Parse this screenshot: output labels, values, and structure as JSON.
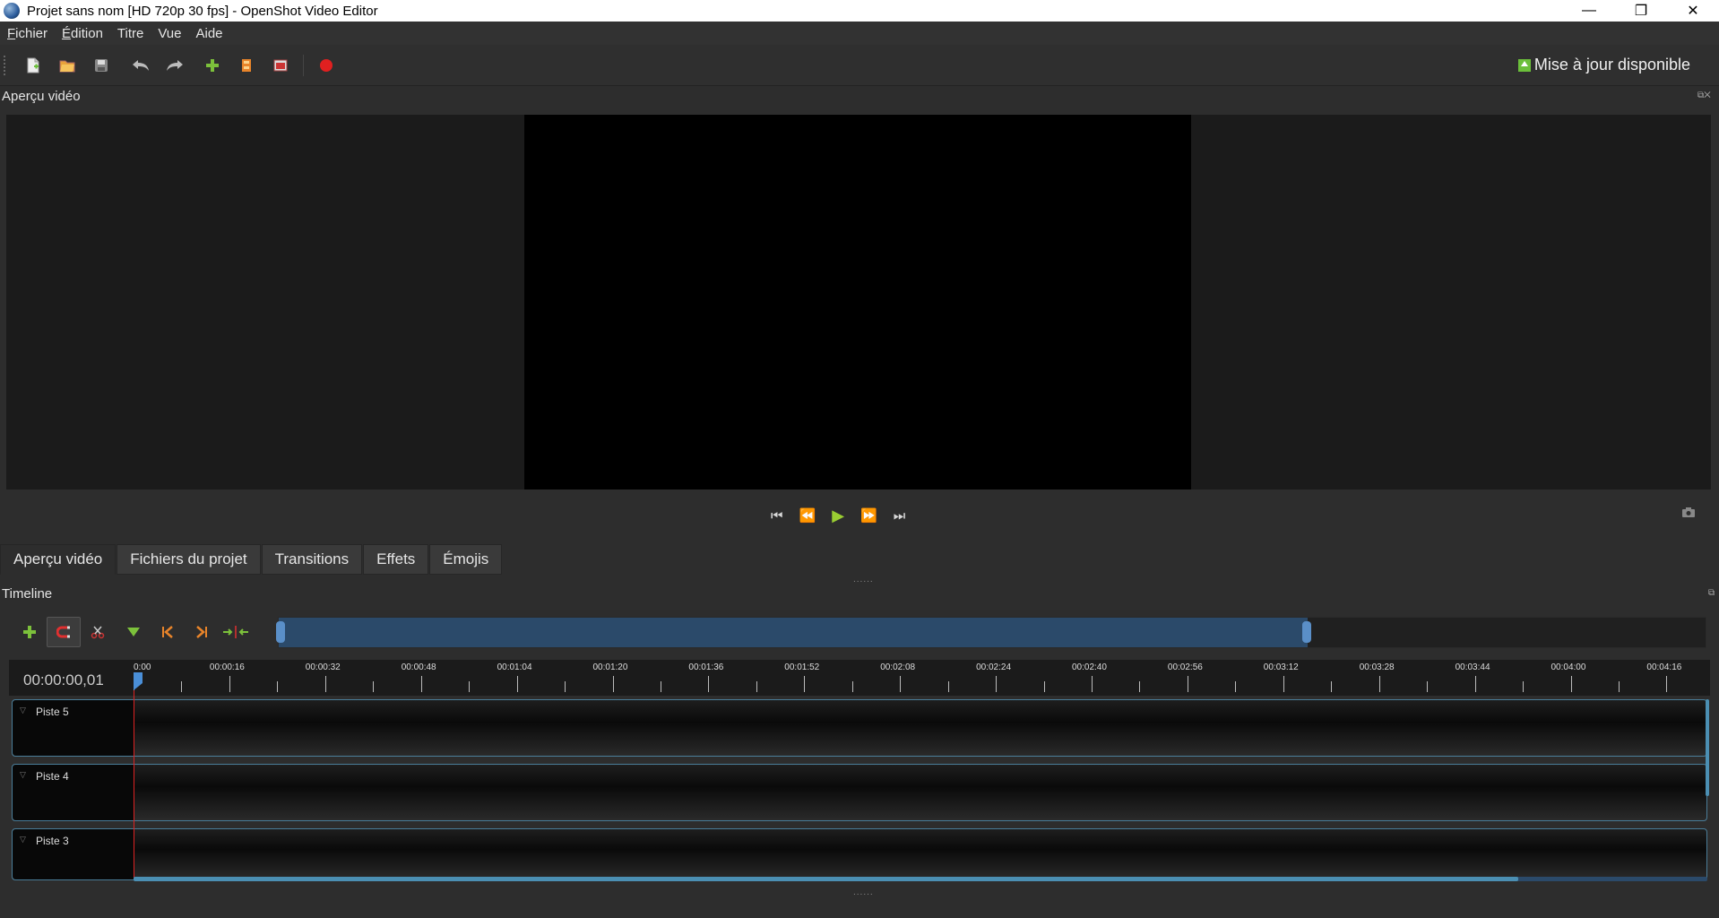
{
  "window": {
    "title": "Projet sans nom [HD 720p 30 fps] - OpenShot Video Editor",
    "minimize": "—",
    "maximize": "❐",
    "close": "✕"
  },
  "menu": [
    {
      "label": "Fichier",
      "accel": "F",
      "rest": "ichier"
    },
    {
      "label": "Édition",
      "accel": "É",
      "rest": "dition"
    },
    {
      "label": "Titre",
      "accel": "",
      "rest": "Titre"
    },
    {
      "label": "Vue",
      "accel": "",
      "rest": "Vue"
    },
    {
      "label": "Aide",
      "accel": "",
      "rest": "Aide"
    }
  ],
  "toolbar": {
    "update_label": "Mise à jour disponible",
    "icons": [
      "new-project-icon",
      "open-project-icon",
      "save-project-icon",
      "undo-icon",
      "redo-icon",
      "import-files-icon",
      "profile-icon",
      "fullscreen-icon",
      "export-video-icon"
    ]
  },
  "preview": {
    "dock_title": "Aperçu vidéo",
    "transport": {
      "jump_start": "⏮",
      "rewind": "⏪",
      "play": "▶",
      "fast_forward": "⏩",
      "jump_end": "⏭"
    }
  },
  "tabs": [
    {
      "label": "Aperçu vidéo",
      "active": true
    },
    {
      "label": "Fichiers du projet",
      "active": false
    },
    {
      "label": "Transitions",
      "active": false
    },
    {
      "label": "Effets",
      "active": false
    },
    {
      "label": "Émojis",
      "active": false
    }
  ],
  "timeline": {
    "dock_title": "Timeline",
    "timecode": "00:00:00,01",
    "ruler_labels": [
      "0:00",
      "00:00:16",
      "00:00:32",
      "00:00:48",
      "00:01:04",
      "00:01:20",
      "00:01:36",
      "00:01:52",
      "00:02:08",
      "00:02:24",
      "00:02:40",
      "00:02:56",
      "00:03:12",
      "00:03:28",
      "00:03:44",
      "00:04:00",
      "00:04:16"
    ],
    "tracks": [
      "Piste 5",
      "Piste 4",
      "Piste 3"
    ],
    "zoom_fraction": 0.72,
    "scroll_fraction": 0.88
  },
  "colors": {
    "accent": "#4b8fb3",
    "playhead": "#dd2222",
    "add_green": "#7cc13b",
    "marker_orange": "#e8842a"
  }
}
